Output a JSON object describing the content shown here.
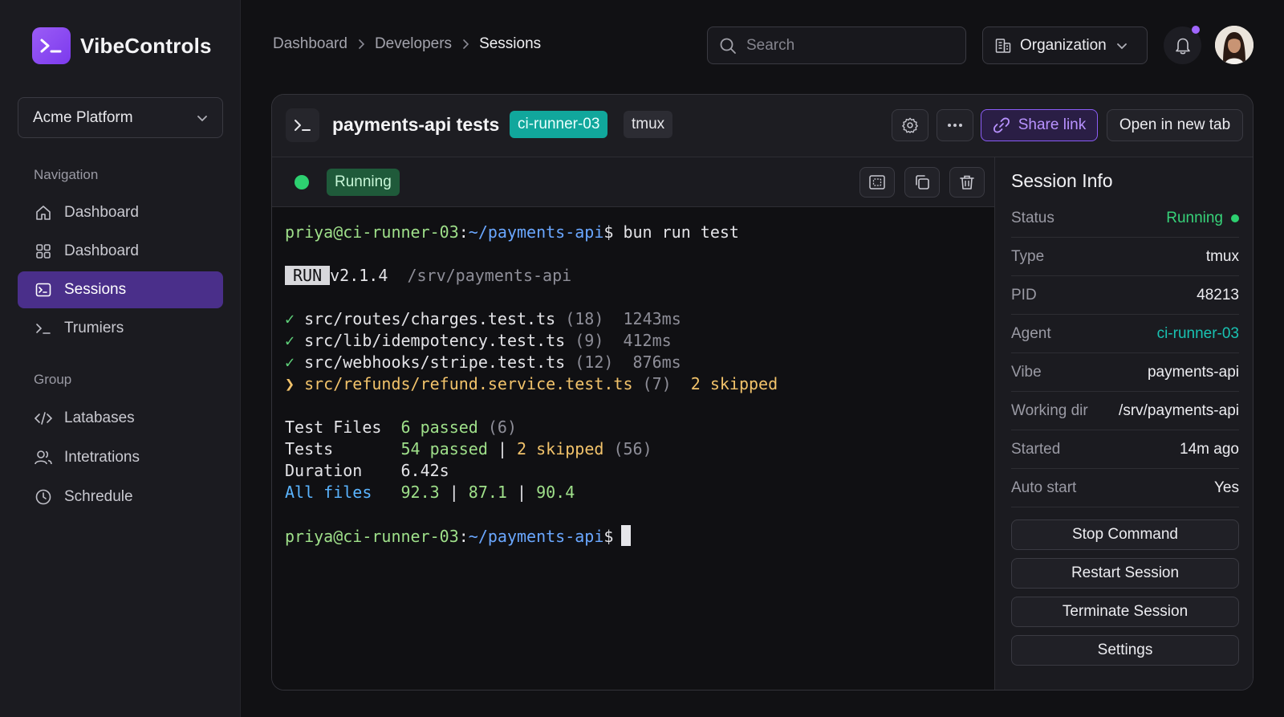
{
  "app": {
    "name": "VibeControls"
  },
  "org_selector": {
    "value": "Acme Platform"
  },
  "sidebar": {
    "sections": [
      {
        "title": "Navigation",
        "items": [
          {
            "label": "Dashboard",
            "icon": "home-icon"
          },
          {
            "label": "Dashboard",
            "icon": "grid-icon"
          },
          {
            "label": "Sessions",
            "icon": "terminal-icon",
            "active": true
          },
          {
            "label": "Trumiers",
            "icon": "prompt-icon"
          }
        ]
      },
      {
        "title": "Group",
        "items": [
          {
            "label": "Latabases",
            "icon": "code-icon"
          },
          {
            "label": "Intetrations",
            "icon": "users-icon"
          },
          {
            "label": "Schredule",
            "icon": "clock-icon"
          }
        ]
      }
    ]
  },
  "breadcrumb": [
    "Dashboard",
    "Developers",
    "Sessions"
  ],
  "search": {
    "placeholder": "Search"
  },
  "org_button": {
    "label": "Organization"
  },
  "session": {
    "title": "payments-api tests",
    "agent_tag": "ci-runner-03",
    "type_tag": "tmux",
    "share_label": "Share link",
    "open_label": "Open in new tab",
    "status": "Running"
  },
  "terminal": {
    "prompt_user": "priya@ci-runner-03",
    "prompt_path": "~/payments-api",
    "command": "bun run test",
    "run_badge": "RUN",
    "version": "v2.1.4",
    "root": "/srv/payments-api",
    "files": [
      {
        "mark": "✓",
        "path": "src/routes/charges.test.ts",
        "count": "(18)",
        "time": "1243ms",
        "state": "pass"
      },
      {
        "mark": "✓",
        "path": "src/lib/idempotency.test.ts",
        "count": "(9)",
        "time": "412ms",
        "state": "pass"
      },
      {
        "mark": "✓",
        "path": "src/webhooks/stripe.test.ts",
        "count": "(12)",
        "time": "876ms",
        "state": "pass"
      },
      {
        "mark": "❯",
        "path": "src/refunds/refund.service.test.ts",
        "count": "(7)",
        "time": "2 skipped",
        "state": "skip"
      }
    ],
    "summary": {
      "files_label": "Test Files",
      "files_passed": "6 passed",
      "files_total": "(6)",
      "tests_label": "Tests",
      "tests_passed": "54 passed",
      "tests_sep": "|",
      "tests_skipped": "2 skipped",
      "tests_total": "(56)",
      "duration_label": "Duration",
      "duration_value": "6.42s",
      "cov_label": "All files",
      "cov_1": "92.3",
      "cov_2": "87.1",
      "cov_3": "90.4"
    }
  },
  "info": {
    "title": "Session Info",
    "rows": [
      {
        "key": "Status",
        "value": "Running"
      },
      {
        "key": "Type",
        "value": "tmux"
      },
      {
        "key": "PID",
        "value": "48213"
      },
      {
        "key": "Agent",
        "value": "ci-runner-03"
      },
      {
        "key": "Vibe",
        "value": "payments-api"
      },
      {
        "key": "Working dir",
        "value": "/srv/payments-api"
      },
      {
        "key": "Started",
        "value": "14m ago"
      },
      {
        "key": "Auto start",
        "value": "Yes"
      }
    ],
    "actions": [
      "Stop Command",
      "Restart Session",
      "Terminate Session",
      "Settings"
    ]
  },
  "colors": {
    "accent": "#8b5cf6",
    "active_nav": "#4a2f8a",
    "agent_tag": "#11a79c",
    "running": "#2dd070",
    "background": "#111114"
  }
}
